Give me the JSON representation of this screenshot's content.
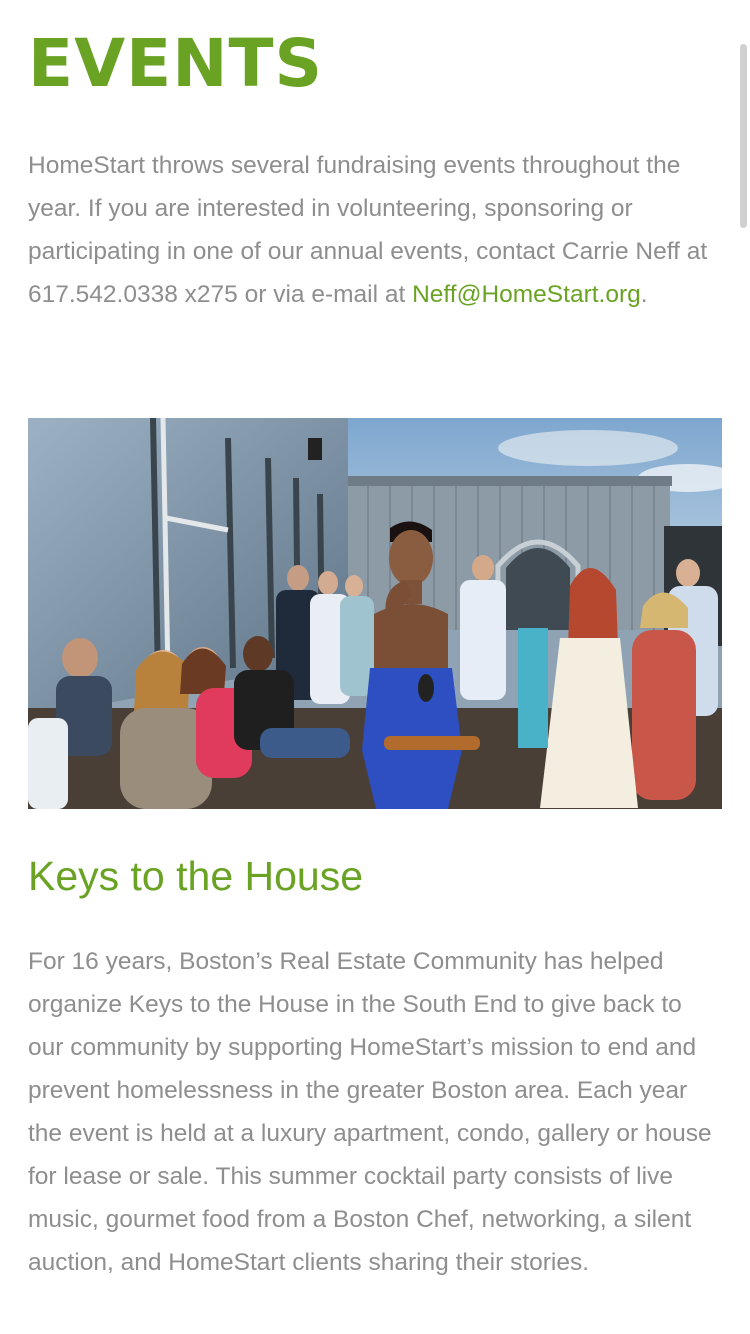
{
  "page": {
    "title": "EVENTS",
    "intro": {
      "text": "HomeStart throws several fundraising events throughout the year. If you are interested in volunteering, sponsoring or participating in one of our annual events, contact Carrie Neff at 617.542.0338 x275 or via e-mail at ",
      "email_link": "Neff@HomeStart.org",
      "trailing": "."
    }
  },
  "section": {
    "title": "Keys to the House",
    "body": "For 16 years, Boston’s Real Estate Community has helped organize Keys to the House in the South End to give back to our community by supporting HomeStart’s mission to end and prevent homelessness in the greater Boston area. Each year the event is held at a luxury apartment, condo, gallery or house for lease or sale. This summer cocktail party consists of live music, gourmet food from a Boston Chef, networking, a silent auction, and HomeStart clients sharing their stories."
  },
  "colors": {
    "accent": "#6aa324",
    "body_text": "#8e8e8e",
    "background": "#ffffff"
  }
}
